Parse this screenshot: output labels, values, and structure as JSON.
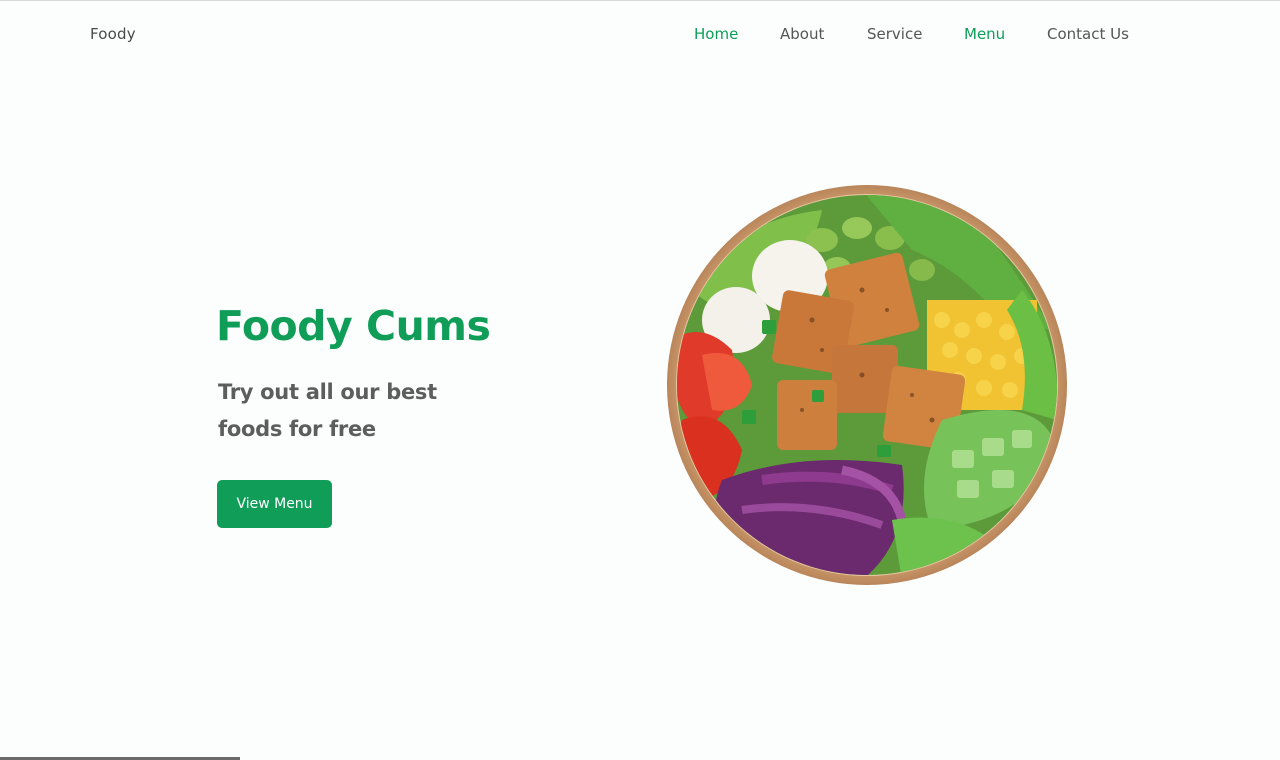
{
  "navbar": {
    "brand": "Foody",
    "links": [
      {
        "label": "Home",
        "active": true
      },
      {
        "label": "About",
        "active": false
      },
      {
        "label": "Service",
        "active": false
      },
      {
        "label": "Menu",
        "active": true
      },
      {
        "label": "Contact Us",
        "active": false
      }
    ]
  },
  "hero": {
    "title": "Foody Cums",
    "subtitle_line1": "Try out all our best",
    "subtitle_line2": "foods for free",
    "button_label": "View Menu",
    "image": "salad-bowl-image"
  },
  "colors": {
    "accent": "#0f9d58",
    "text_muted": "#5d5d5d",
    "background": "#fbfefd"
  }
}
